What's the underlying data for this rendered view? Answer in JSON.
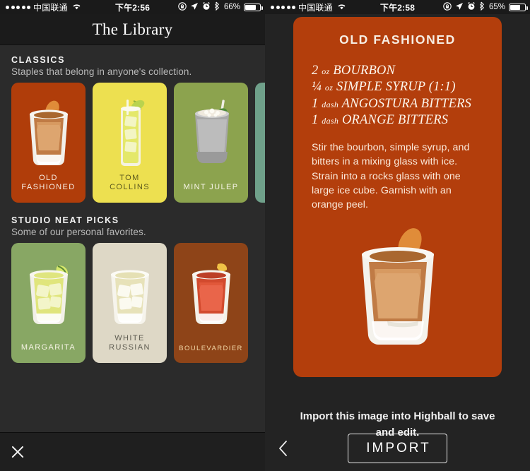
{
  "left": {
    "statusbar": {
      "carrier": "中国联通",
      "time": "下午2:56",
      "battery_pct": "66%",
      "battery_level": 66,
      "icons": [
        "signal-dots",
        "wifi-icon",
        "rotation-lock-icon",
        "location-arrow-icon",
        "alarm-clock-icon",
        "bluetooth-icon",
        "battery-icon"
      ]
    },
    "nav_title": "The Library",
    "sections": [
      {
        "title": "CLASSICS",
        "subtitle": "Staples that belong in anyone's collection.",
        "cards": [
          {
            "label": "OLD\nFASHIONED",
            "bg": "#b03d0a",
            "text": "#f7eee4",
            "art": "old-fashioned"
          },
          {
            "label": "TOM\nCOLLINS",
            "bg": "#ede050",
            "text": "#5d5a1e",
            "art": "tom-collins"
          },
          {
            "label": "MINT JULEP",
            "bg": "#8ca34e",
            "text": "#f7f4e6",
            "art": "mint-julep"
          },
          {
            "label": "",
            "bg": "#6fa08a",
            "text": "#ffffff",
            "art": "partial"
          }
        ]
      },
      {
        "title": "STUDIO NEAT PICKS",
        "subtitle": "Some of our personal favorites.",
        "cards": [
          {
            "label": "MARGARITA",
            "bg": "#88a764",
            "text": "#f7f4e6",
            "art": "margarita"
          },
          {
            "label": "WHITE\nRUSSIAN",
            "bg": "#ded8c6",
            "text": "#5f5d52",
            "art": "white-russian"
          },
          {
            "label": "BOULEVARDIER",
            "bg": "#8e4418",
            "text": "#f4d9a8",
            "art": "boulevardier"
          }
        ]
      }
    ],
    "close_label": "close"
  },
  "right": {
    "statusbar": {
      "carrier": "中国联通",
      "time": "下午2:58",
      "battery_pct": "65%",
      "battery_level": 65
    },
    "recipe": {
      "title": "OLD FASHIONED",
      "ingredients": [
        {
          "amount": "2",
          "unit": "oz",
          "name": "BOURBON"
        },
        {
          "amount": "¼",
          "unit": "oz",
          "name": "SIMPLE SYRUP (1:1)"
        },
        {
          "amount": "1",
          "unit": "dash",
          "name": "ANGOSTURA BITTERS"
        },
        {
          "amount": "1",
          "unit": "dash",
          "name": "ORANGE BITTERS"
        }
      ],
      "instructions": "Stir the bourbon, simple syrup, and bitters in a mixing glass with ice. Strain into a rocks glass with one large ice cube. Garnish with an orange peel.",
      "card_bg": "#b33e0c"
    },
    "import_note": "Import this image into Highball to save and edit.",
    "import_label": "IMPORT",
    "back_label": "back"
  }
}
